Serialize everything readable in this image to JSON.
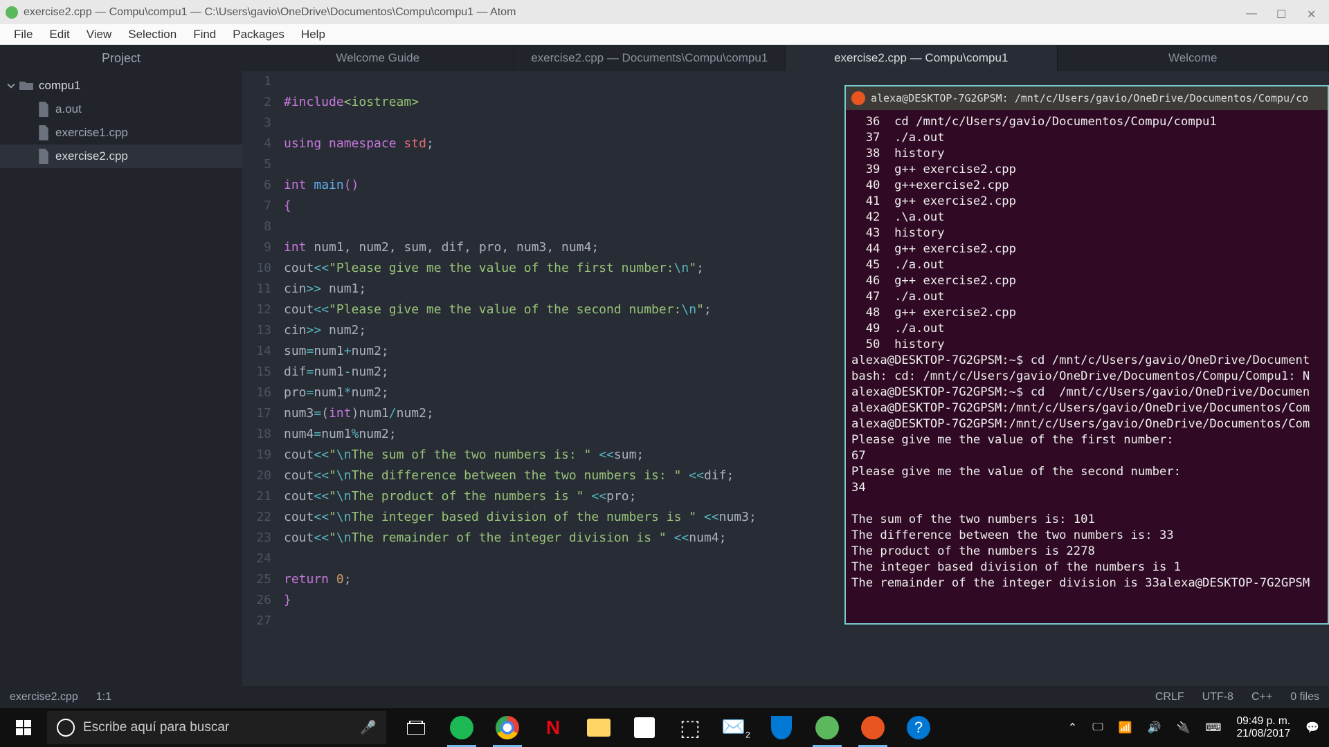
{
  "window": {
    "title": "exercise2.cpp — Compu\\compu1 — C:\\Users\\gavio\\OneDrive\\Documentos\\Compu\\compu1 — Atom"
  },
  "menu": {
    "file": "File",
    "edit": "Edit",
    "view": "View",
    "selection": "Selection",
    "find": "Find",
    "packages": "Packages",
    "help": "Help"
  },
  "sidebar": {
    "header": "Project",
    "root": "compu1",
    "files": [
      {
        "name": "a.out"
      },
      {
        "name": "exercise1.cpp"
      },
      {
        "name": "exercise2.cpp"
      }
    ]
  },
  "tabs": [
    {
      "label": "Welcome Guide"
    },
    {
      "label": "exercise2.cpp — Documents\\Compu\\compu1"
    },
    {
      "label": "exercise2.cpp — Compu\\compu1"
    },
    {
      "label": "Welcome"
    }
  ],
  "statusbar": {
    "file": "exercise2.cpp",
    "pos": "1:1",
    "eol": "CRLF",
    "enc": "UTF-8",
    "lang": "C++",
    "files_count": "0 files"
  },
  "terminal": {
    "title": "alexa@DESKTOP-7G2GPSM: /mnt/c/Users/gavio/OneDrive/Documentos/Compu/co",
    "history": [
      "  36  cd /mnt/c/Users/gavio/Documentos/Compu/compu1",
      "  37  ./a.out",
      "  38  history",
      "  39  g++ exercise2.cpp",
      "  40  g++exercise2.cpp",
      "  41  g++ exercise2.cpp",
      "  42  .\\a.out",
      "  43  history",
      "  44  g++ exercise2.cpp",
      "  45  ./a.out",
      "  46  g++ exercise2.cpp",
      "  47  ./a.out",
      "  48  g++ exercise2.cpp",
      "  49  ./a.out",
      "  50  history"
    ],
    "prompt1": "alexa@DESKTOP-7G2GPSM:~$ cd /mnt/c/Users/gavio/OneDrive/Document",
    "bash_err": "bash: cd: /mnt/c/Users/gavio/OneDrive/Documentos/Compu/Compu1: N",
    "prompt2": "alexa@DESKTOP-7G2GPSM:~$ cd  /mnt/c/Users/gavio/OneDrive/Documen",
    "prompt3": "alexa@DESKTOP-7G2GPSM:/mnt/c/Users/gavio/OneDrive/Documentos/Com",
    "prompt4": "alexa@DESKTOP-7G2GPSM:/mnt/c/Users/gavio/OneDrive/Documentos/Com",
    "out": [
      "Please give me the value of the first number:",
      "67",
      "Please give me the value of the second number:",
      "34",
      "",
      "The sum of the two numbers is: 101",
      "The difference between the two numbers is: 33",
      "The product of the numbers is 2278",
      "The integer based division of the numbers is 1",
      "The remainder of the integer division is 33alexa@DESKTOP-7G2GPSM"
    ]
  },
  "taskbar": {
    "search_placeholder": "Escribe aquí para buscar",
    "time": "09:49 p. m.",
    "date": "21/08/2017"
  },
  "code": {
    "lines": 27
  }
}
